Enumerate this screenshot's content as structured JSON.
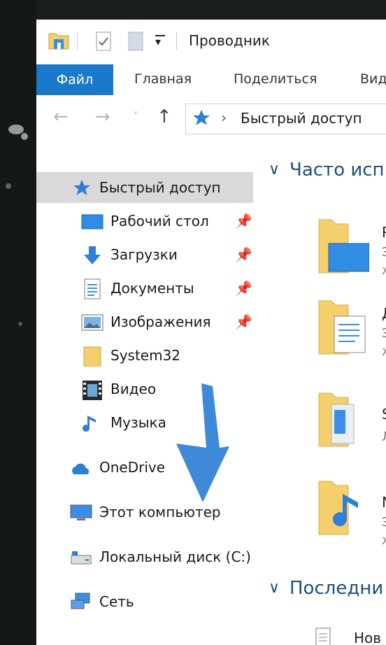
{
  "window": {
    "title": "Проводник"
  },
  "ribbon": {
    "tabs": [
      "Файл",
      "Главная",
      "Поделиться",
      "Вид"
    ]
  },
  "navbar": {
    "back": "←",
    "forward": "→",
    "recent": "˅",
    "up": "↑",
    "path_sep": "›",
    "path": "Быстрый доступ"
  },
  "sidebar": {
    "quick_access": "Быстрый доступ",
    "items": [
      {
        "label": "Рабочий стол",
        "icon": "desktop-icon",
        "pinned": true
      },
      {
        "label": "Загрузки",
        "icon": "downloads-icon",
        "pinned": true
      },
      {
        "label": "Документы",
        "icon": "documents-icon",
        "pinned": true
      },
      {
        "label": "Изображения",
        "icon": "pictures-icon",
        "pinned": true
      },
      {
        "label": "System32",
        "icon": "folder-icon",
        "pinned": false
      },
      {
        "label": "Видео",
        "icon": "video-icon",
        "pinned": false
      },
      {
        "label": "Музыка",
        "icon": "music-icon",
        "pinned": false
      }
    ],
    "onedrive": "OneDrive",
    "this_pc": "Этот компьютер",
    "local_disk": "Локальный диск (C:)",
    "network": "Сеть"
  },
  "content": {
    "section1": "Часто исп",
    "section2": "Последни",
    "tiles": [
      {
        "title": "Р",
        "sub1": "Э",
        "sub2": "ж"
      },
      {
        "title": "Д",
        "sub1": "Э",
        "sub2": "ж"
      },
      {
        "title": "S",
        "sub1": "Л",
        "sub2": ""
      },
      {
        "title": "М",
        "sub1": "Э",
        "sub2": "ж"
      }
    ],
    "recent_item": "Нов"
  },
  "colors": {
    "accent": "#1b79c9",
    "selection": "#d9d9d9",
    "arrow": "#2f7fd6",
    "folder": "#f4cf6b"
  }
}
